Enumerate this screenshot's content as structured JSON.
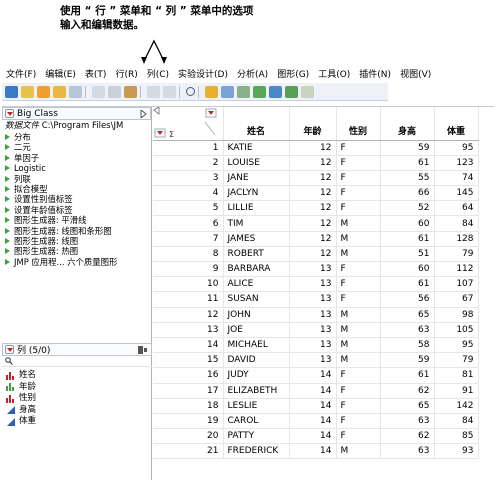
{
  "callout": {
    "line1": "使用 “ 行 ” 菜单和 “ 列 ” 菜单中的选项",
    "line2": "输入和编辑数据。"
  },
  "menu": [
    "文件(F)",
    "编辑(E)",
    "表(T)",
    "行(R)",
    "列(C)",
    "实验设计(D)",
    "分析(A)",
    "图形(G)",
    "工具(O)",
    "插件(N)",
    "视图(V)"
  ],
  "table_panel": {
    "title": "Big Class",
    "path_key": "数据文件",
    "path_value": "C:\\Program Files\\JM",
    "scripts": [
      "分布",
      "二元",
      "单因子",
      "Logistic",
      "列联",
      "拟合模型",
      "设置性别值标签",
      "设置年龄值标签",
      "图形生成器: 平滑线",
      "图形生成器: 线图和条形图",
      "图形生成器: 线图",
      "图形生成器: 热图",
      "JMP 应用程... 六个质量图形"
    ]
  },
  "columns_panel": {
    "title": "列 (5/0)",
    "search_placeholder": "",
    "columns": [
      {
        "name": "姓名",
        "icon": "nominal-bar-icon",
        "color": "#c0262c"
      },
      {
        "name": "年龄",
        "icon": "ordinal-bar-icon",
        "color": "#3aa53a"
      },
      {
        "name": "性别",
        "icon": "nominal-bar-icon",
        "color": "#c0262c"
      },
      {
        "name": "身高",
        "icon": "continuous-triangle-icon",
        "color": "#2f5fb0"
      },
      {
        "name": "体重",
        "icon": "continuous-triangle-icon",
        "color": "#2f5fb0"
      }
    ]
  },
  "grid": {
    "headers": [
      "姓名",
      "年龄",
      "性别",
      "身高",
      "体重"
    ],
    "rows": [
      [
        1,
        "KATIE",
        12,
        "F",
        59,
        95
      ],
      [
        2,
        "LOUISE",
        12,
        "F",
        61,
        123
      ],
      [
        3,
        "JANE",
        12,
        "F",
        55,
        74
      ],
      [
        4,
        "JACLYN",
        12,
        "F",
        66,
        145
      ],
      [
        5,
        "LILLIE",
        12,
        "F",
        52,
        64
      ],
      [
        6,
        "TIM",
        12,
        "M",
        60,
        84
      ],
      [
        7,
        "JAMES",
        12,
        "M",
        61,
        128
      ],
      [
        8,
        "ROBERT",
        12,
        "M",
        51,
        79
      ],
      [
        9,
        "BARBARA",
        13,
        "F",
        60,
        112
      ],
      [
        10,
        "ALICE",
        13,
        "F",
        61,
        107
      ],
      [
        11,
        "SUSAN",
        13,
        "F",
        56,
        67
      ],
      [
        12,
        "JOHN",
        13,
        "M",
        65,
        98
      ],
      [
        13,
        "JOE",
        13,
        "M",
        63,
        105
      ],
      [
        14,
        "MICHAEL",
        13,
        "M",
        58,
        95
      ],
      [
        15,
        "DAVID",
        13,
        "M",
        59,
        79
      ],
      [
        16,
        "JUDY",
        14,
        "F",
        61,
        81
      ],
      [
        17,
        "ELIZABETH",
        14,
        "F",
        62,
        91
      ],
      [
        18,
        "LESLIE",
        14,
        "F",
        65,
        142
      ],
      [
        19,
        "CAROL",
        14,
        "F",
        63,
        84
      ],
      [
        20,
        "PATTY",
        14,
        "F",
        62,
        85
      ],
      [
        21,
        "FREDERICK",
        14,
        "M",
        63,
        93
      ]
    ]
  },
  "colors": {
    "nominal": "#c0262c",
    "ordinal": "#3aa53a",
    "continuous": "#2f5fb0",
    "toolbar_bg": "#eef2f8"
  }
}
